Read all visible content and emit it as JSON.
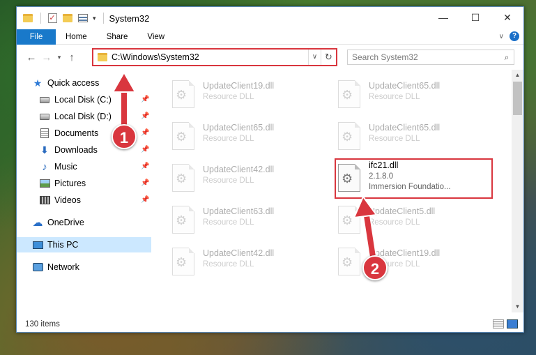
{
  "window": {
    "title": "System32"
  },
  "controls": {
    "minimize": "—",
    "maximize": "☐",
    "close": "✕"
  },
  "ribbon": {
    "tabs": [
      "File",
      "Home",
      "Share",
      "View"
    ],
    "help": "?"
  },
  "address": {
    "path": "C:\\Windows\\System32"
  },
  "search": {
    "placeholder": "Search System32"
  },
  "sidebar": {
    "items": [
      {
        "label": "Quick access",
        "icon": "star-icon",
        "pinned": false
      },
      {
        "label": "Local Disk (C:)",
        "icon": "drive-icon",
        "pinned": true
      },
      {
        "label": "Local Disk (D:)",
        "icon": "drive-icon",
        "pinned": true
      },
      {
        "label": "Documents",
        "icon": "documents-icon",
        "pinned": true
      },
      {
        "label": "Downloads",
        "icon": "downloads-icon",
        "pinned": true
      },
      {
        "label": "Music",
        "icon": "music-icon",
        "pinned": true
      },
      {
        "label": "Pictures",
        "icon": "pictures-icon",
        "pinned": true
      },
      {
        "label": "Videos",
        "icon": "videos-icon",
        "pinned": true
      },
      {
        "label": "OneDrive",
        "icon": "onedrive-icon",
        "pinned": false
      },
      {
        "label": "This PC",
        "icon": "this-pc-icon",
        "pinned": false,
        "selected": true
      },
      {
        "label": "Network",
        "icon": "network-icon",
        "pinned": false
      }
    ]
  },
  "files": [
    {
      "name": "UpdateClient19.dll",
      "type": "Resource DLL"
    },
    {
      "name": "UpdateClient65.dll",
      "type": "Resource DLL"
    },
    {
      "name": "UpdateClient65.dll",
      "type": "Resource DLL"
    },
    {
      "name": "UpdateClient65.dll",
      "type": "Resource DLL"
    },
    {
      "name": "UpdateClient42.dll",
      "type": "Resource DLL"
    },
    {
      "name": "ifc21.dll",
      "version": "2.1.8.0",
      "company": "Immersion Foundatio..."
    },
    {
      "name": "UpdateClient63.dll",
      "type": "Resource DLL"
    },
    {
      "name": "UpdateClient5.dll",
      "type": "Resource DLL"
    },
    {
      "name": "UpdateClient42.dll",
      "type": "Resource DLL"
    },
    {
      "name": "UpdateClient19.dll",
      "type": "Resource DLL"
    }
  ],
  "status": {
    "count": "130 items"
  },
  "annotations": {
    "step1": "1",
    "step2": "2"
  },
  "colors": {
    "accent": "#1979ca",
    "highlight": "#d9363e",
    "selected": "#cce8ff"
  }
}
